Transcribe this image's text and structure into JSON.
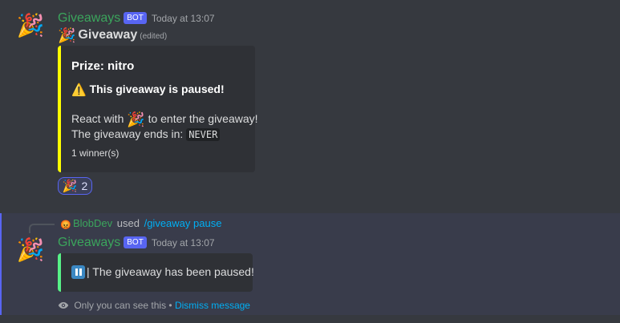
{
  "message1": {
    "author": "Giveaways",
    "bot_tag": "BOT",
    "timestamp": "Today at 13:07",
    "content_title": "Giveaway",
    "edited": "(edited)",
    "embed": {
      "accent_color": "#ffff00",
      "title": "Prize: nitro",
      "paused_text": "This giveaway is paused!",
      "react_prefix": "React with",
      "react_suffix": "to enter the giveaway!",
      "ends_prefix": "The giveaway ends in:",
      "ends_value": "NEVER",
      "winners": "1 winner(s)"
    },
    "reaction": {
      "emoji": "party-popper",
      "count": "2"
    }
  },
  "message2": {
    "reply": {
      "user": "BlobDev",
      "used": "used",
      "command": "/giveaway pause"
    },
    "author": "Giveaways",
    "bot_tag": "BOT",
    "timestamp": "Today at 13:07",
    "embed": {
      "accent_color": "#57f287",
      "text": "| The giveaway has been paused!"
    },
    "ephemeral_note": "Only you can see this •",
    "dismiss_label": "Dismiss message"
  },
  "icons": {
    "avatar": "party-popper-icon",
    "warning": "warning-icon",
    "pause": "pause-button-icon",
    "eye": "eye-icon"
  },
  "colors": {
    "background": "#36393f",
    "username": "#3ba55c",
    "bot_tag": "#5865f2",
    "link": "#00aff4"
  }
}
